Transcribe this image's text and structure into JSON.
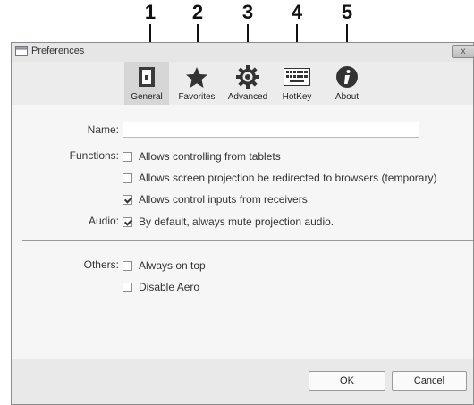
{
  "callouts": [
    "1",
    "2",
    "3",
    "4",
    "5"
  ],
  "window": {
    "title": "Preferences",
    "close_glyph": "x"
  },
  "toolbar": {
    "items": [
      {
        "label": "General",
        "icon": "general-icon",
        "selected": true
      },
      {
        "label": "Favorites",
        "icon": "star-icon",
        "selected": false
      },
      {
        "label": "Advanced",
        "icon": "gear-icon",
        "selected": false
      },
      {
        "label": "HotKey",
        "icon": "keyboard-icon",
        "selected": false
      },
      {
        "label": "About",
        "icon": "info-icon",
        "selected": false
      }
    ]
  },
  "form": {
    "name_label": "Name:",
    "name_value": "",
    "functions_label": "Functions:",
    "functions": [
      {
        "label": "Allows controlling from tablets",
        "checked": false
      },
      {
        "label": "Allows screen projection be redirected to browsers (temporary)",
        "checked": false
      },
      {
        "label": "Allows control inputs from receivers",
        "checked": true
      }
    ],
    "audio_label": "Audio:",
    "audio": {
      "label": "By default, always mute projection audio.",
      "checked": true
    },
    "others_label": "Others:",
    "others": [
      {
        "label": "Always on top",
        "checked": false
      },
      {
        "label": "Disable Aero",
        "checked": false
      }
    ]
  },
  "buttons": {
    "ok": "OK",
    "cancel": "Cancel"
  }
}
